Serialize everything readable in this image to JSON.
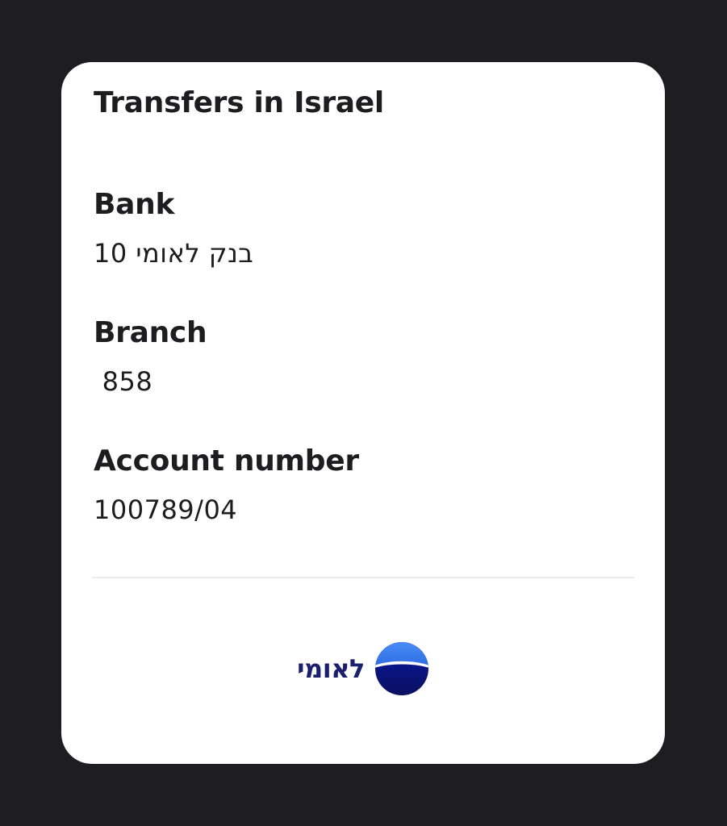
{
  "card": {
    "title": "Transfers in Israel",
    "fields": [
      {
        "label": "Bank",
        "value": "בנק לאומי 10"
      },
      {
        "label": "Branch",
        "value": " 858"
      },
      {
        "label": "Account number",
        "value": "100789/04"
      }
    ],
    "logo": {
      "text": "לאומי",
      "icon": "leumi-logo-icon",
      "colors": {
        "top": "#3b7ff0",
        "bottom": "#0c1470",
        "text": "#1a1f6e"
      }
    }
  }
}
